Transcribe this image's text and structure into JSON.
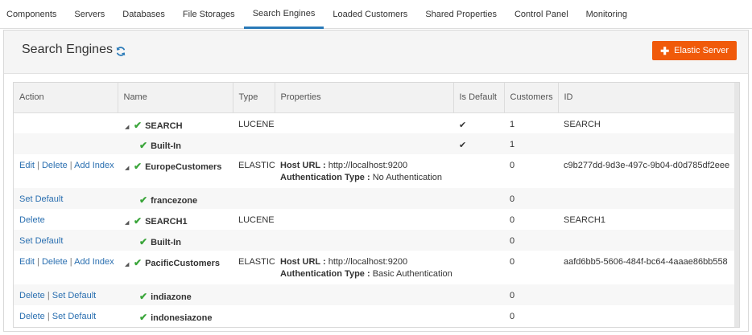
{
  "tabs": [
    {
      "label": "Components",
      "active": false
    },
    {
      "label": "Servers",
      "active": false
    },
    {
      "label": "Databases",
      "active": false
    },
    {
      "label": "File Storages",
      "active": false
    },
    {
      "label": "Search Engines",
      "active": true
    },
    {
      "label": "Loaded Customers",
      "active": false
    },
    {
      "label": "Shared Properties",
      "active": false
    },
    {
      "label": "Control Panel",
      "active": false
    },
    {
      "label": "Monitoring",
      "active": false
    }
  ],
  "header": {
    "title": "Search Engines",
    "add_button_label": "Elastic Server"
  },
  "table": {
    "columns": [
      "Action",
      "Name",
      "Type",
      "Properties",
      "Is Default",
      "Customers",
      "ID"
    ],
    "rows": [
      {
        "actions": [],
        "name": "SEARCH",
        "level": 0,
        "type": "LUCENE",
        "properties": [],
        "is_default": true,
        "customers": "1",
        "id": "SEARCH"
      },
      {
        "actions": [],
        "name": "Built-In",
        "level": 1,
        "type": "",
        "properties": [],
        "is_default": true,
        "customers": "1",
        "id": ""
      },
      {
        "actions": [
          "Edit",
          "Delete",
          "Add Index"
        ],
        "name": "EuropeCustomers",
        "level": 0,
        "type": "ELASTIC",
        "properties": [
          {
            "key": "Host URL :",
            "value": "http://localhost:9200"
          },
          {
            "key": "Authentication Type :",
            "value": "No Authentication"
          }
        ],
        "is_default": false,
        "customers": "0",
        "id": "c9b277dd-9d3e-497c-9b04-d0d785df2eee"
      },
      {
        "actions": [
          "Set Default"
        ],
        "name": "francezone",
        "level": 1,
        "type": "",
        "properties": [],
        "is_default": false,
        "customers": "0",
        "id": ""
      },
      {
        "actions": [
          "Delete"
        ],
        "name": "SEARCH1",
        "level": 0,
        "type": "LUCENE",
        "properties": [],
        "is_default": false,
        "customers": "0",
        "id": "SEARCH1"
      },
      {
        "actions": [
          "Set Default"
        ],
        "name": "Built-In",
        "level": 1,
        "type": "",
        "properties": [],
        "is_default": false,
        "customers": "0",
        "id": ""
      },
      {
        "actions": [
          "Edit",
          "Delete",
          "Add Index"
        ],
        "name": "PacificCustomers",
        "level": 0,
        "type": "ELASTIC",
        "properties": [
          {
            "key": "Host URL :",
            "value": "http://localhost:9200"
          },
          {
            "key": "Authentication Type :",
            "value": "Basic Authentication"
          }
        ],
        "is_default": false,
        "customers": "0",
        "id": "aafd6bb5-5606-484f-bc64-4aaae86bb558"
      },
      {
        "actions": [
          "Delete",
          "Set Default"
        ],
        "name": "indiazone",
        "level": 1,
        "type": "",
        "properties": [],
        "is_default": false,
        "customers": "0",
        "id": ""
      },
      {
        "actions": [
          "Delete",
          "Set Default"
        ],
        "name": "indonesiazone",
        "level": 1,
        "type": "",
        "properties": [],
        "is_default": false,
        "customers": "0",
        "id": ""
      }
    ]
  },
  "icons": {
    "refresh": "refresh-icon",
    "expand": "caret-expanded-icon",
    "status": "check-icon",
    "default": "checkmark-icon",
    "add": "plus-icon"
  },
  "colors": {
    "accent": "#2a7ab8",
    "button": "#f05a0a",
    "status_check": "#3aa53a",
    "link": "#2a6fb0"
  }
}
